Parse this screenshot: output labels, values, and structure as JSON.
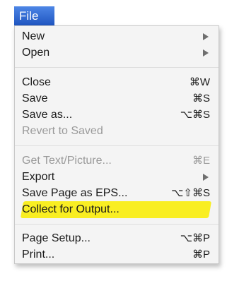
{
  "menu_bar": {
    "title": "File"
  },
  "colors": {
    "menu_bar_bg": "#2f64c8",
    "highlight": "#f9ee22",
    "disabled_text": "#9a9a9a"
  },
  "menu": {
    "new": {
      "label": "New",
      "submenu_icon": "arrow-right-icon"
    },
    "open": {
      "label": "Open",
      "submenu_icon": "arrow-right-icon"
    },
    "close": {
      "label": "Close",
      "shortcut": "⌘W"
    },
    "save": {
      "label": "Save",
      "shortcut": "⌘S"
    },
    "save_as": {
      "label": "Save as...",
      "shortcut": "⌥⌘S"
    },
    "revert": {
      "label": "Revert to Saved"
    },
    "get_text": {
      "label": "Get Text/Picture...",
      "shortcut": "⌘E"
    },
    "export": {
      "label": "Export",
      "submenu_icon": "arrow-right-icon"
    },
    "save_eps": {
      "label": "Save Page as EPS...",
      "shortcut": "⌥⇧⌘S"
    },
    "collect": {
      "label": "Collect for Output..."
    },
    "page_setup": {
      "label": "Page Setup...",
      "shortcut": "⌥⌘P"
    },
    "print": {
      "label": "Print...",
      "shortcut": "⌘P"
    }
  }
}
